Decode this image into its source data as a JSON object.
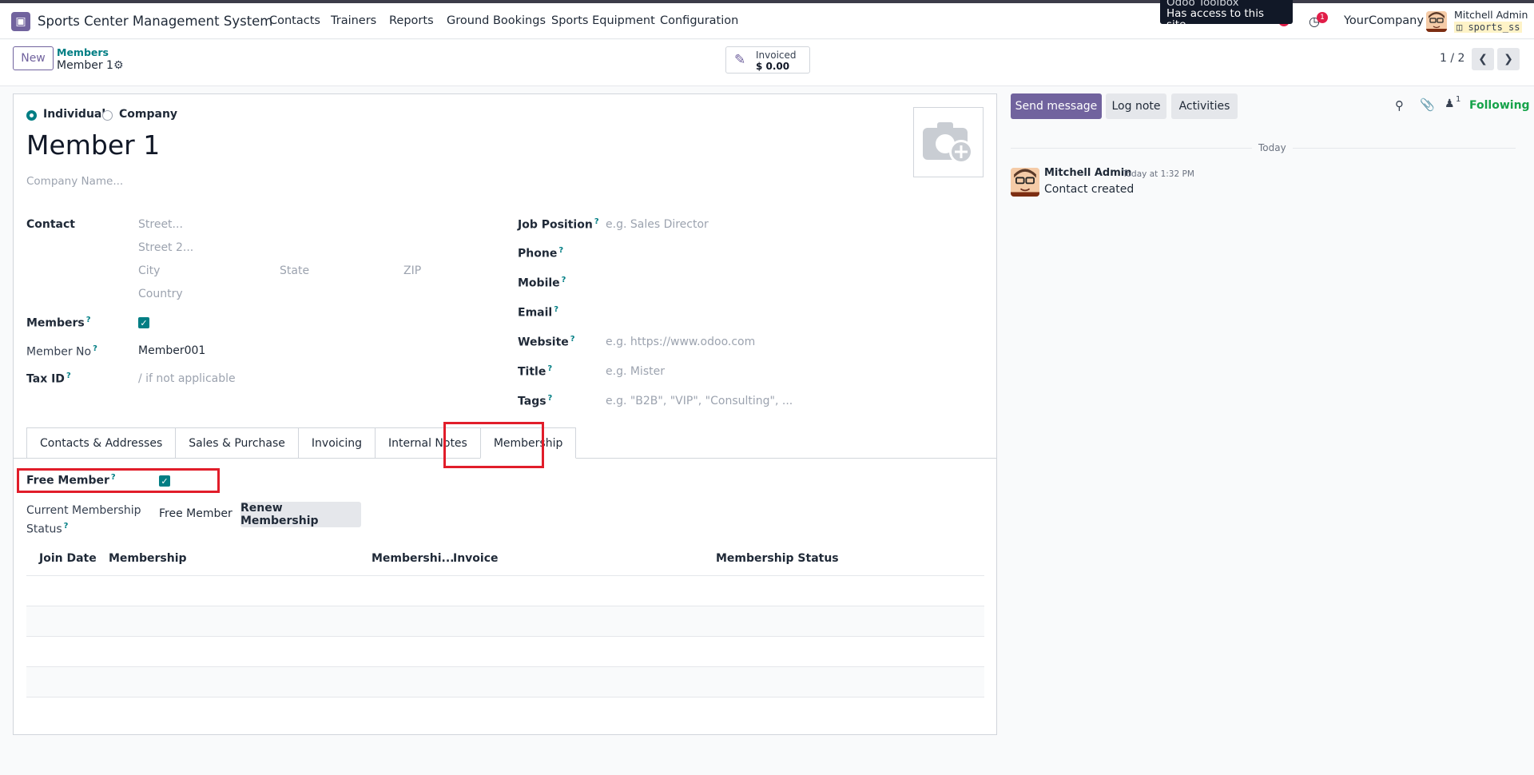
{
  "app": {
    "title": "Sports Center Management System"
  },
  "menu": [
    "Contacts",
    "Trainers",
    "Reports",
    "Ground Bookings",
    "Sports Equipment",
    "Configuration"
  ],
  "tooltip": {
    "title": "Odoo Toolbox",
    "text": "Has access to this site"
  },
  "systray": {
    "activity_badge": "1",
    "company": "YourCompany",
    "user_name": "Mitchell Admin",
    "database": "sports_ss"
  },
  "control": {
    "new_label": "New",
    "breadcrumb_parent": "Members",
    "breadcrumb_current": "Member 1",
    "smart_button": {
      "label": "Invoiced",
      "value": "$ 0.00"
    },
    "pager": "1 / 2"
  },
  "form": {
    "type_individual": "Individual",
    "type_company": "Company",
    "name": "Member 1",
    "company_placeholder": "Company Name...",
    "contact_label": "Contact",
    "street_ph": "Street...",
    "street2_ph": "Street 2...",
    "city_ph": "City",
    "state_ph": "State",
    "zip_ph": "ZIP",
    "country_ph": "Country",
    "members_label": "Members",
    "member_no_label": "Member No",
    "member_no_value": "Member001",
    "tax_id_label": "Tax ID",
    "tax_id_ph": "/ if not applicable",
    "job_position_label": "Job Position",
    "job_position_ph": "e.g. Sales Director",
    "phone_label": "Phone",
    "mobile_label": "Mobile",
    "email_label": "Email",
    "website_label": "Website",
    "website_ph": "e.g. https://www.odoo.com",
    "title_label": "Title",
    "title_ph": "e.g. Mister",
    "tags_label": "Tags",
    "tags_ph": "e.g. \"B2B\", \"VIP\", \"Consulting\", ..."
  },
  "tabs": [
    "Contacts & Addresses",
    "Sales & Purchase",
    "Invoicing",
    "Internal Notes",
    "Membership"
  ],
  "membership": {
    "free_member_label": "Free Member",
    "status_label_1": "Current Membership",
    "status_label_2": "Status",
    "status_value": "Free Member",
    "renew_label": "Renew Membership",
    "columns": [
      "Join Date",
      "Membership",
      "Membershi...",
      "Invoice",
      "Membership Status"
    ]
  },
  "chatter": {
    "send_message": "Send message",
    "log_note": "Log note",
    "activities": "Activities",
    "followers_count": "1",
    "following": "Following",
    "today": "Today",
    "message": {
      "author": "Mitchell Admin",
      "time": "Today at 1:32 PM",
      "body": "Contact created"
    }
  },
  "colors": {
    "brand": "#71639e",
    "accent": "#017e84",
    "highlight": "#e11d2a",
    "following": "#16a34a"
  }
}
